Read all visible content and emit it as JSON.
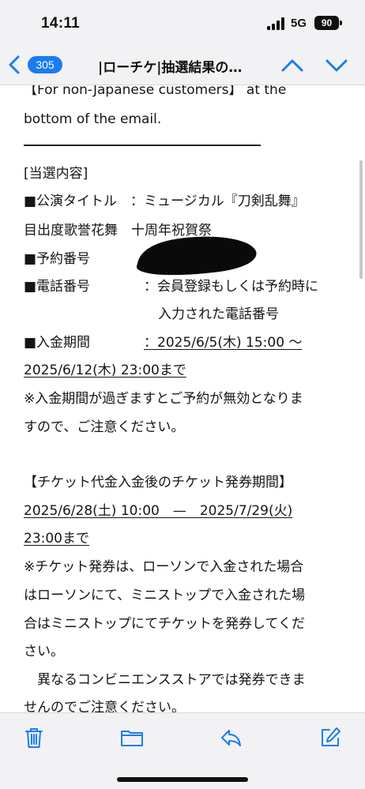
{
  "status": {
    "time": "14:11",
    "network": "5G",
    "battery": "90"
  },
  "nav": {
    "unread_count": "305",
    "title": "|ローチケ|抽選結果の…"
  },
  "body": {
    "lines": [
      "【For non-Japanese customers】 at the",
      "bottom of the email.",
      "[当選内容]",
      "■公演タイトル　：ミュージカル『刀剣乱舞』",
      "目出度歌誉花舞　十周年祝賀祭",
      "■予約番号",
      "■電話番号",
      "：会員登録もしくは予約時に",
      "入力された電話番号",
      "■入金期間",
      "：2025/6/5(木) 15:00 〜",
      "2025/6/12(木) 23:00まで",
      "※入金期間が過ぎますとご予約が無効となりま",
      "すので、ご注意ください。",
      "【チケット代金入金後のチケット発券期間】",
      "2025/6/28(土) 10:00　—　2025/7/29(火)",
      "23:00まで",
      "※チケット発券は、ローソンで入金された場合",
      "はローソンにて、ミニストップで入金された場",
      "合はミニストップにてチケットを発券してくだ",
      "さい。",
      "　異なるコンビニエンスストアでは発券できま",
      "せんのでご注意ください。"
    ]
  },
  "colors": {
    "accent": "#1a7cf0",
    "bar_bg": "#f2f2f4"
  }
}
